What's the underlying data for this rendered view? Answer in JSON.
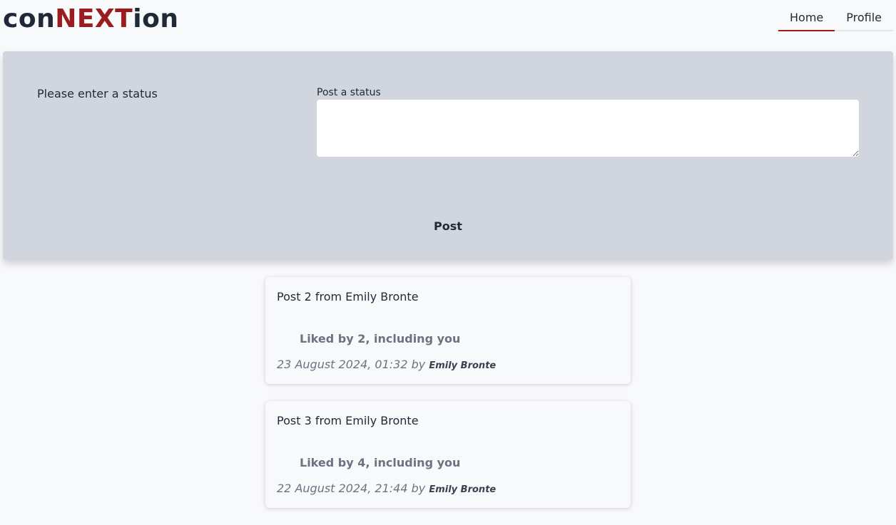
{
  "app": {
    "logo": {
      "prefix": "con",
      "accent": "NEXT",
      "suffix": "ion"
    },
    "accent_color": "#9b1c1f"
  },
  "nav": {
    "tabs": [
      {
        "label": "Home",
        "active": true
      },
      {
        "label": "Profile",
        "active": false
      }
    ]
  },
  "composer": {
    "message": "Please enter a status",
    "field_label": "Post a status",
    "input_value": "",
    "button_label": "Post"
  },
  "posts": [
    {
      "text": "Post 2 from Emily Bronte",
      "likes": "Liked by 2, including you",
      "timestamp": "23 August 2024, 01:32",
      "by": "by",
      "author": "Emily Bronte"
    },
    {
      "text": "Post 3 from Emily Bronte",
      "likes": "Liked by 4, including you",
      "timestamp": "22 August 2024, 21:44",
      "by": "by",
      "author": "Emily Bronte"
    }
  ]
}
